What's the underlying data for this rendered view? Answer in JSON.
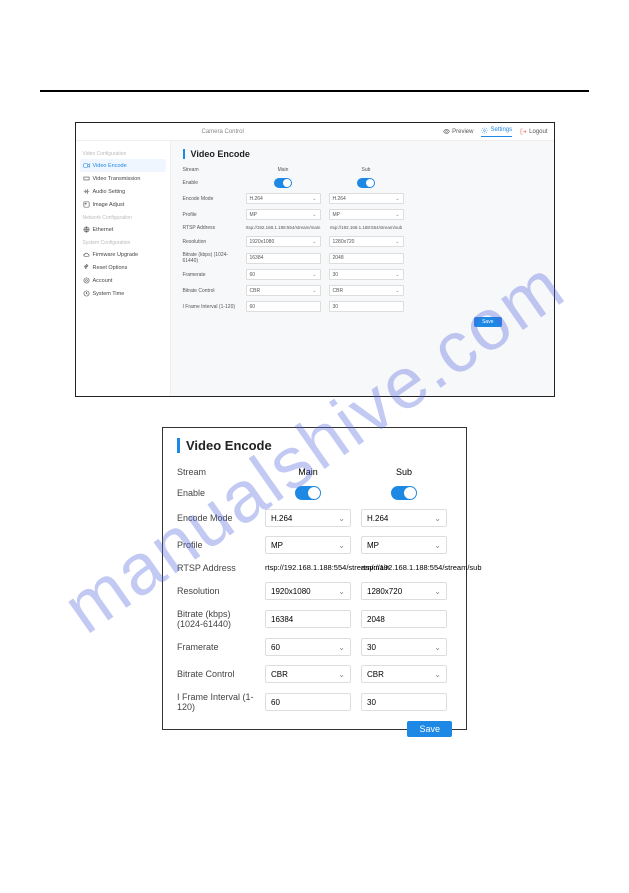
{
  "watermark": "manualshive.com",
  "topbar": {
    "title": "Camera Control",
    "preview": "Preview",
    "settings": "Settings",
    "logout": "Logout"
  },
  "sidebar": {
    "section_video": "Video Configuration",
    "video_encode": "Video Encode",
    "video_transmission": "Video Transmission",
    "audio_setting": "Audio Setting",
    "image_adjust": "Image Adjust",
    "section_network": "Network Configuration",
    "ethernet": "Ethernet",
    "section_system": "System Configuration",
    "firmware_upgrade": "Firmware Upgrade",
    "reset_options": "Reset Options",
    "account": "Account",
    "system_time": "System Time"
  },
  "form": {
    "title": "Video Encode",
    "stream": "Stream",
    "main": "Main",
    "sub": "Sub",
    "enable": "Enable",
    "encode_mode": "Encode Mode",
    "encode_main": "H.264",
    "encode_sub": "H.264",
    "profile": "Profile",
    "profile_main": "MP",
    "profile_sub": "MP",
    "rtsp_address": "RTSP Address",
    "rtsp_main": "rtsp://192.168.1.188:554/stream/main",
    "rtsp_sub": "rtsp://192.168.1.188:554/stream/sub",
    "resolution": "Resolution",
    "resolution_main": "1920x1080",
    "resolution_sub": "1280x720",
    "bitrate": "Bitrate (kbps) (1024-61440)",
    "bitrate_main": "16384",
    "bitrate_sub": "2048",
    "framerate": "Framerate",
    "framerate_main": "60",
    "framerate_sub": "30",
    "bitrate_control": "Bitrate Control",
    "bc_main": "CBR",
    "bc_sub": "CBR",
    "iframe": "I Frame Interval (1-120)",
    "iframe_main": "60",
    "iframe_sub": "30",
    "save": "Save"
  }
}
